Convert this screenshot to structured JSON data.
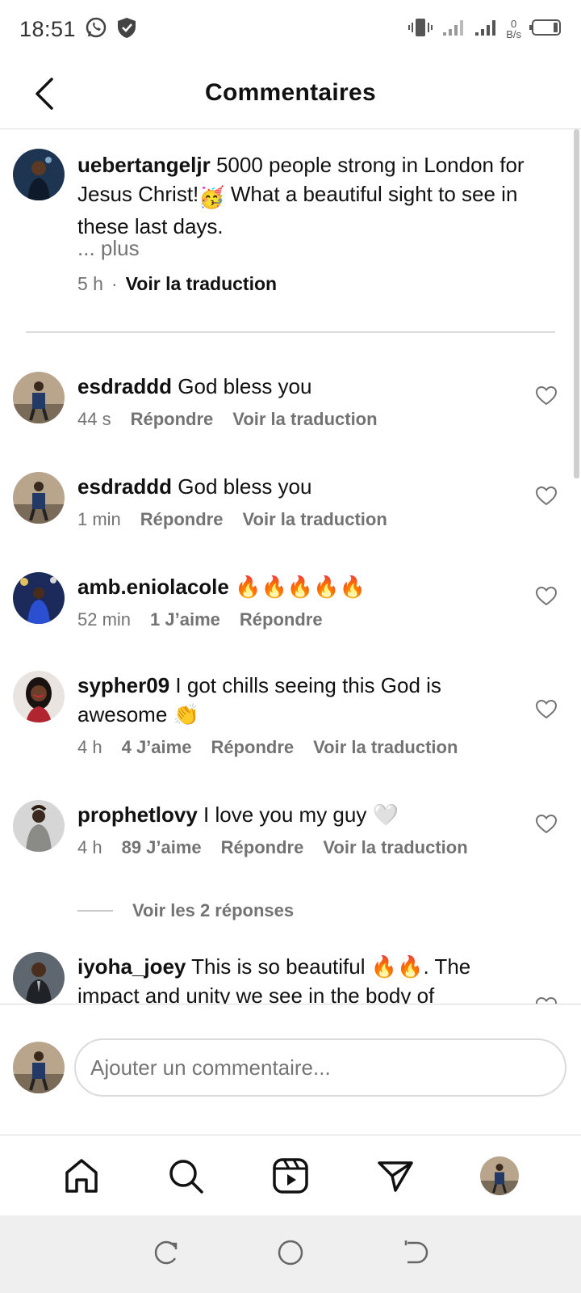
{
  "status_bar": {
    "time": "18:51",
    "net_speed_value": "0",
    "net_speed_unit": "B/s",
    "icons": [
      "whatsapp-icon",
      "shield-icon",
      "vibrate-icon",
      "signal-icon",
      "signal-icon",
      "battery-icon"
    ]
  },
  "header": {
    "title": "Commentaires",
    "back_icon": "chevron-left-icon"
  },
  "caption": {
    "username": "uebertangeljr",
    "text_1": " 5000 people strong in London for Jesus Christ!",
    "emoji": "🥳",
    "text_2": " What a beautiful sight to see in these last days.",
    "more": "... plus",
    "time": "5 h",
    "separator": "·",
    "translate": "Voir la traduction"
  },
  "comments": [
    {
      "username": "esdraddd",
      "text": " God bless you",
      "time": "44 s",
      "reply": "Répondre",
      "translate": "Voir la traduction"
    },
    {
      "username": "esdraddd",
      "text": " God bless you",
      "time": "1 min",
      "reply": "Répondre",
      "translate": "Voir la traduction"
    },
    {
      "username": "amb.eniolacole",
      "text": " 🔥🔥🔥🔥🔥",
      "time": "52 min",
      "likes": "1 J’aime",
      "reply": "Répondre"
    },
    {
      "username": "sypher09",
      "text": " I got chills seeing this God is awesome 👏",
      "time": "4 h",
      "likes": "4 J’aime",
      "reply": "Répondre",
      "translate": "Voir la traduction"
    },
    {
      "username": "prophetlovy",
      "text": " I love you my guy 🤍",
      "time": "4 h",
      "likes": "89 J’aime",
      "reply": "Répondre",
      "translate": "Voir la traduction"
    },
    {
      "username": "iyoha_joey",
      "text": " This is so beautiful 🔥🔥. The impact and unity we see in the body of"
    }
  ],
  "view_replies": "Voir les 2 réponses",
  "composer": {
    "placeholder": "Ajouter un commentaire..."
  },
  "bottom_nav": [
    "home-icon",
    "search-icon",
    "reels-icon",
    "direct-icon",
    "profile-avatar"
  ],
  "system_nav": [
    "recent-apps-icon",
    "home-circle-icon",
    "back-icon"
  ],
  "colors": {
    "text": "#111111",
    "secondary": "#737373",
    "divider": "#dbdbdb",
    "system_nav_bg": "#efefef"
  }
}
